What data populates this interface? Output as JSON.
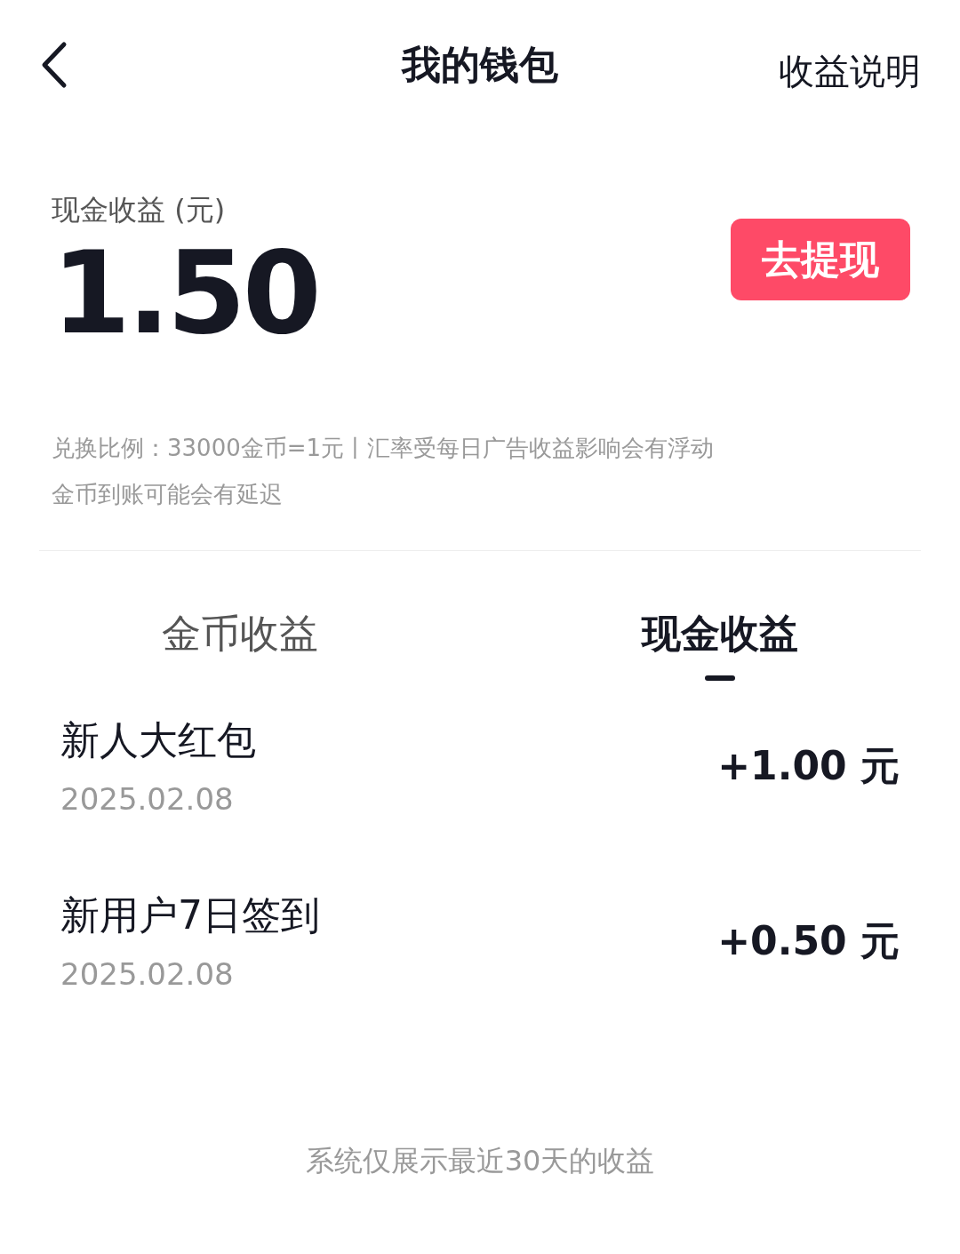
{
  "header": {
    "title": "我的钱包",
    "action": "收益说明"
  },
  "balance": {
    "label": "现金收益 (元)",
    "amount": "1.50"
  },
  "withdraw_button": "去提现",
  "notes": [
    "兑换比例：33000金币=1元丨汇率受每日广告收益影响会有浮动",
    "金币到账可能会有延迟"
  ],
  "tabs": [
    {
      "label": "金币收益",
      "selected": false
    },
    {
      "label": "现金收益",
      "selected": true
    }
  ],
  "records": [
    {
      "title": "新人大红包",
      "date": "2025.02.08",
      "amount": "+1.00 元"
    },
    {
      "title": "新用户7日签到",
      "date": "2025.02.08",
      "amount": "+0.50 元"
    }
  ],
  "footer": "系统仅展示最近30天的收益"
}
